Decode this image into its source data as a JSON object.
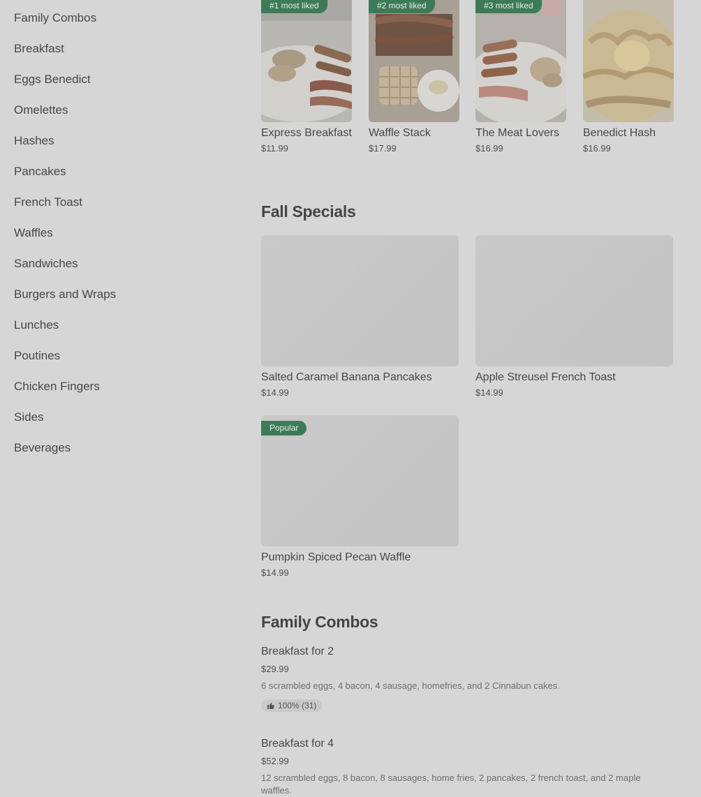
{
  "sidebar": {
    "categories": [
      "Family Combos",
      "Breakfast",
      "Eggs Benedict",
      "Omelettes",
      "Hashes",
      "Pancakes",
      "French Toast",
      "Waffles",
      "Sandwiches",
      "Burgers and Wraps",
      "Lunches",
      "Poutines",
      "Chicken Fingers",
      "Sides",
      "Beverages"
    ]
  },
  "most_liked": [
    {
      "badge": "#1 most liked",
      "title": "Express Breakfast",
      "price": "$11.99"
    },
    {
      "badge": "#2 most liked",
      "title": "Waffle Stack",
      "price": "$17.99"
    },
    {
      "badge": "#3 most liked",
      "title": "The Meat Lovers",
      "price": "$16.99"
    },
    {
      "badge": "",
      "title": "Benedict Hash",
      "price": "$16.99"
    }
  ],
  "fall_specials": {
    "heading": "Fall Specials",
    "items": [
      {
        "title": "Salted Caramel Banana Pancakes",
        "price": "$14.99"
      },
      {
        "title": "Apple Streusel French Toast",
        "price": "$14.99"
      },
      {
        "badge": "Popular",
        "title": "Pumpkin Spiced Pecan Waffle",
        "price": "$14.99"
      }
    ]
  },
  "family_combos": {
    "heading": "Family Combos",
    "items": [
      {
        "title": "Breakfast for 2",
        "price": "$29.99",
        "desc": "6 scrambled eggs, 4 bacon, 4 sausage, homefries, and 2 Cinnabun cakes.",
        "rating": "100% (31)"
      },
      {
        "title": "Breakfast for 4",
        "price": "$52.99",
        "desc": "12 scrambled eggs, 8 bacon, 8 sausages, home fries, 2 pancakes, 2 french toast, and 2 maple waffles."
      }
    ]
  },
  "colors": {
    "badge_green": "#3f7a58",
    "overlay_gray": "#d6d6d6"
  },
  "icons": [
    "thumbs-up-icon"
  ]
}
